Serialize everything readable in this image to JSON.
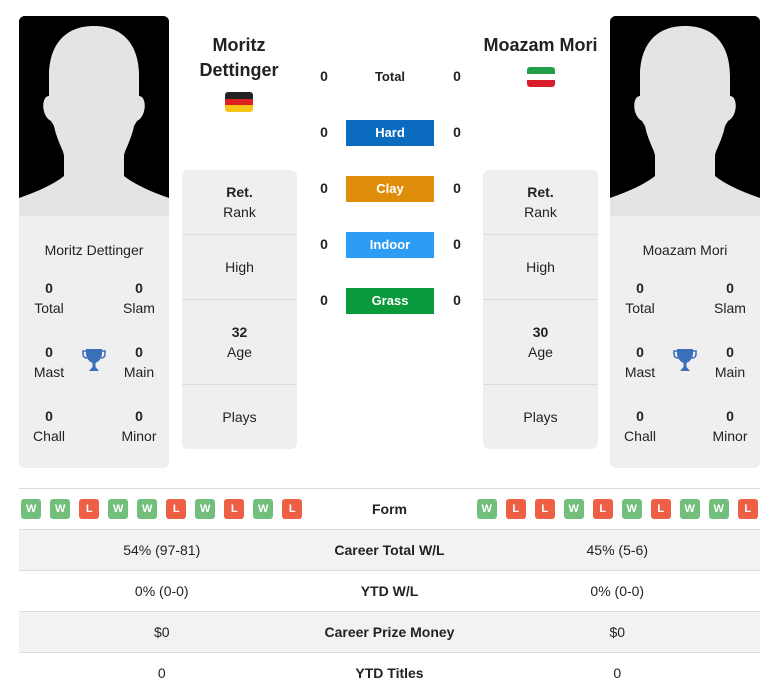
{
  "players": [
    {
      "name": "Moritz Dettinger",
      "title_line1": "Moritz",
      "title_line2": "Dettinger",
      "flag": "germany-flag",
      "stats": {
        "total": "0",
        "slam": "0",
        "mast": "0",
        "main": "0",
        "chall": "0",
        "minor": "0"
      },
      "info": {
        "rank_value": "Ret.",
        "rank_label": "Rank",
        "high_label": "High",
        "age_value": "32",
        "age_label": "Age",
        "plays_label": "Plays"
      },
      "surfaces": {
        "total": "0",
        "hard": "0",
        "clay": "0",
        "indoor": "0",
        "grass": "0"
      },
      "form": [
        "W",
        "W",
        "L",
        "W",
        "W",
        "L",
        "W",
        "L",
        "W",
        "L"
      ],
      "career_wl": "54% (97-81)",
      "ytd_wl": "0% (0-0)",
      "prize": "$0",
      "ytd_titles": "0"
    },
    {
      "name": "Moazam Mori",
      "title_line1": "Moazam Mori",
      "title_line2": "",
      "flag": "iran-flag",
      "stats": {
        "total": "0",
        "slam": "0",
        "mast": "0",
        "main": "0",
        "chall": "0",
        "minor": "0"
      },
      "info": {
        "rank_value": "Ret.",
        "rank_label": "Rank",
        "high_label": "High",
        "age_value": "30",
        "age_label": "Age",
        "plays_label": "Plays"
      },
      "surfaces": {
        "total": "0",
        "hard": "0",
        "clay": "0",
        "indoor": "0",
        "grass": "0"
      },
      "form": [
        "W",
        "L",
        "L",
        "W",
        "L",
        "W",
        "L",
        "W",
        "W",
        "L"
      ],
      "career_wl": "45% (5-6)",
      "ytd_wl": "0% (0-0)",
      "prize": "$0",
      "ytd_titles": "0"
    }
  ],
  "stat_labels": {
    "total": "Total",
    "slam": "Slam",
    "mast": "Mast",
    "main": "Main",
    "chall": "Chall",
    "minor": "Minor"
  },
  "surfaces": [
    {
      "key": "total",
      "label": "Total",
      "color": ""
    },
    {
      "key": "hard",
      "label": "Hard",
      "color": "#0b6bbf"
    },
    {
      "key": "clay",
      "label": "Clay",
      "color": "#df8e0b"
    },
    {
      "key": "indoor",
      "label": "Indoor",
      "color": "#2d9cf5"
    },
    {
      "key": "grass",
      "label": "Grass",
      "color": "#0a9a3c"
    }
  ],
  "rows": {
    "form": "Form",
    "career_wl": "Career Total W/L",
    "ytd_wl": "YTD W/L",
    "prize": "Career Prize Money",
    "ytd_titles": "YTD Titles"
  },
  "colors": {
    "win": "#72bf7b",
    "loss": "#ee5f45",
    "trophy": "#3a6fba"
  }
}
